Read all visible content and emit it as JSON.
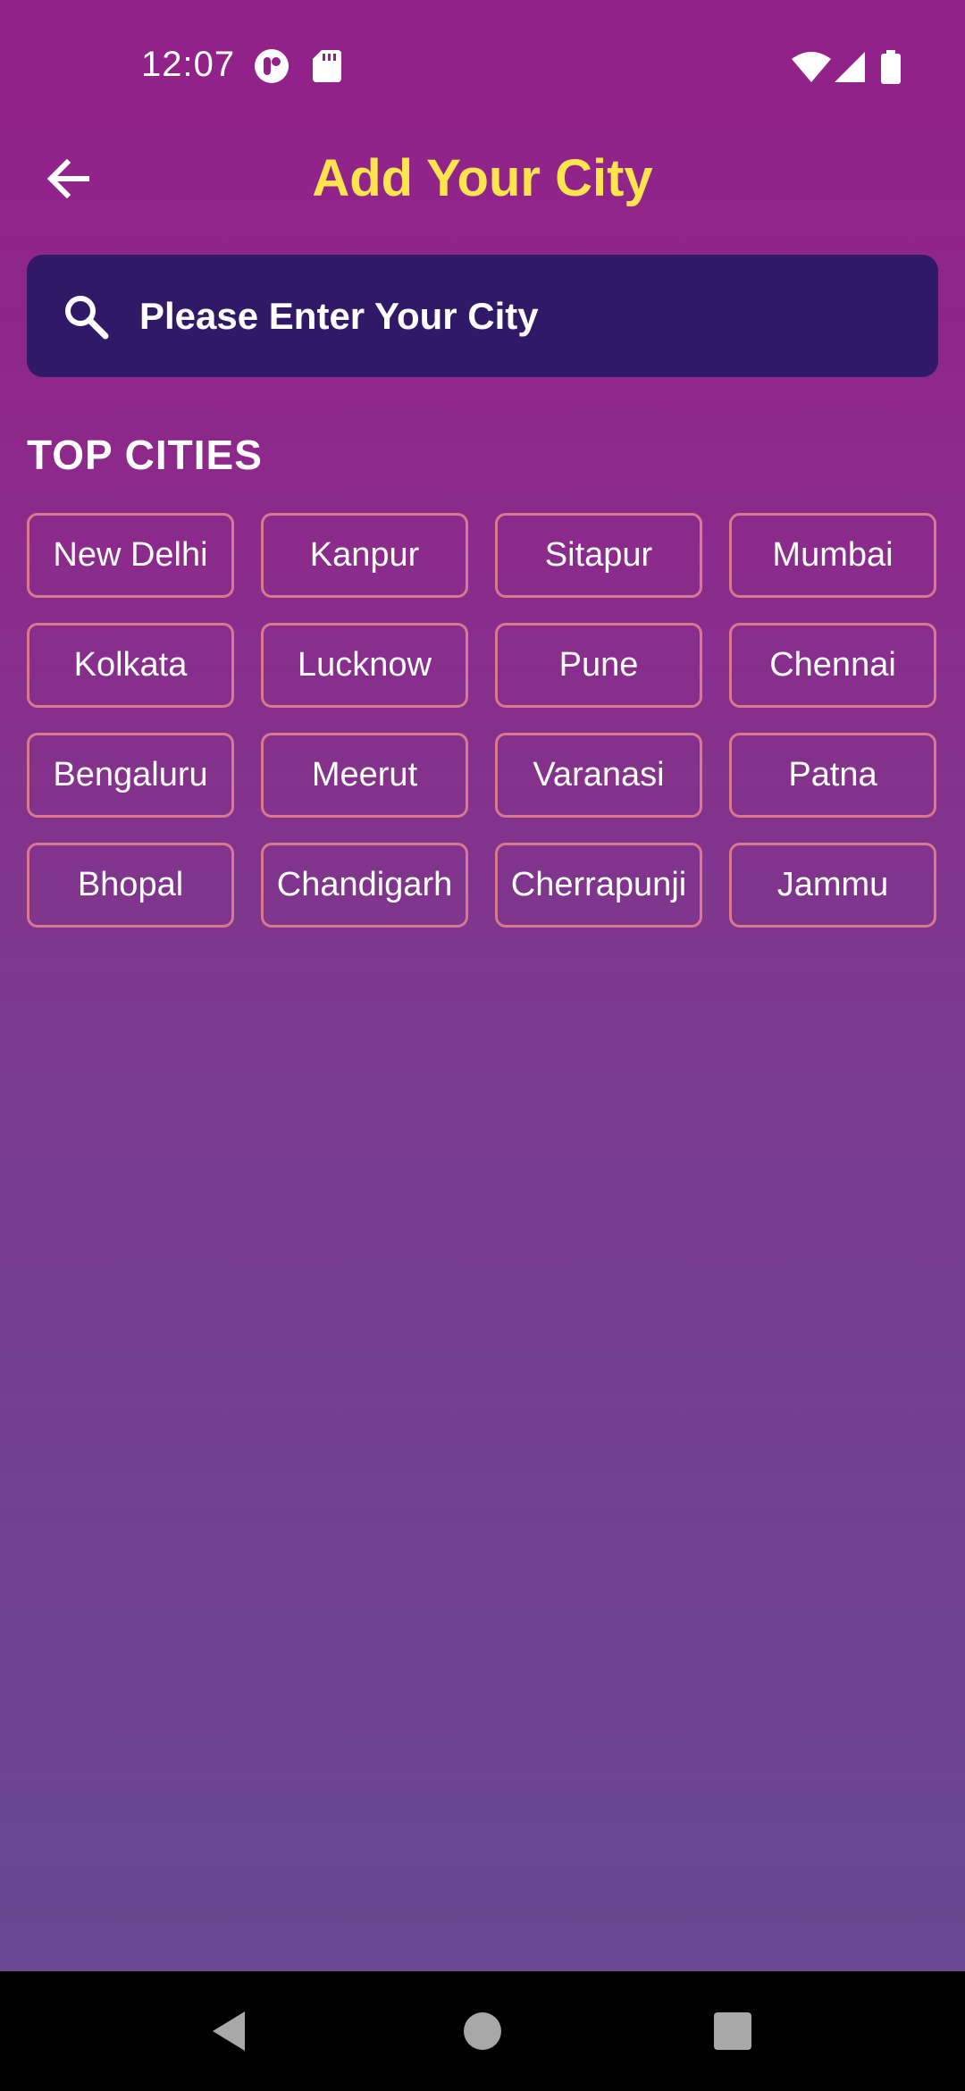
{
  "status_bar": {
    "time": "12:07",
    "icons": [
      "notification-app-icon",
      "sd-card-icon",
      "wifi-icon",
      "signal-icon",
      "battery-icon"
    ]
  },
  "header": {
    "title": "Add Your City",
    "back_icon": "arrow-back-icon"
  },
  "search": {
    "placeholder": "Please Enter Your City",
    "value": "",
    "icon": "search-icon"
  },
  "top_cities": {
    "heading": "TOP CITIES",
    "cities": [
      "New Delhi",
      "Kanpur",
      "Sitapur",
      "Mumbai",
      "Kolkata",
      "Lucknow",
      "Pune",
      "Chennai",
      "Bengaluru",
      "Meerut",
      "Varanasi",
      "Patna",
      "Bhopal",
      "Chandigarh",
      "Cherrapunji",
      "Jammu"
    ]
  },
  "nav_bar": {
    "icons": [
      "back-triangle-icon",
      "home-circle-icon",
      "recents-square-icon"
    ]
  },
  "colors": {
    "title": "#ffe44d",
    "search_bg": "#301966",
    "chip_border": "#d9788f",
    "gradient_top": "#922189",
    "gradient_bottom": "#684990"
  }
}
